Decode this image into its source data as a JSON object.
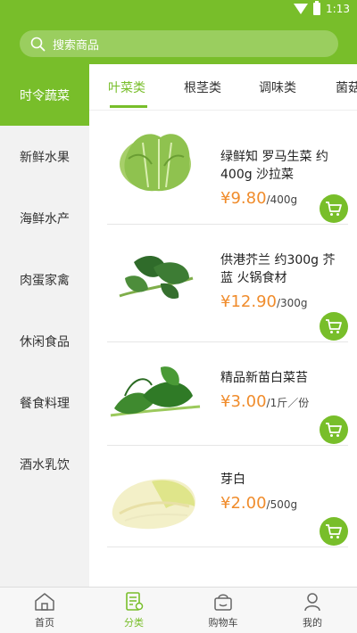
{
  "status": {
    "time": "1:13"
  },
  "search": {
    "placeholder": "搜索商品"
  },
  "sidebar": {
    "items": [
      {
        "label": "时令蔬菜"
      },
      {
        "label": "新鲜水果"
      },
      {
        "label": "海鲜水产"
      },
      {
        "label": "肉蛋家禽"
      },
      {
        "label": "休闲食品"
      },
      {
        "label": "餐食料理"
      },
      {
        "label": "酒水乳饮"
      }
    ]
  },
  "tabs": {
    "items": [
      {
        "label": "叶菜类"
      },
      {
        "label": "根茎类"
      },
      {
        "label": "调味类"
      },
      {
        "label": "菌菇"
      }
    ]
  },
  "products": [
    {
      "name": "绿鲜知 罗马生菜 约400g 沙拉菜",
      "price": "¥9.80",
      "unit": "/400g"
    },
    {
      "name": "供港芥兰 约300g 芥蓝 火锅食材",
      "price": "¥12.90",
      "unit": "/300g"
    },
    {
      "name": "精品新苗白菜苔",
      "price": "¥3.00",
      "unit": "/1斤／份"
    },
    {
      "name": "芽白",
      "price": "¥2.00",
      "unit": "/500g"
    }
  ],
  "bottom_nav": {
    "items": [
      {
        "label": "首页"
      },
      {
        "label": "分类"
      },
      {
        "label": "购物车"
      },
      {
        "label": "我的"
      }
    ]
  },
  "colors": {
    "accent": "#78be2a",
    "price": "#f08c2c"
  }
}
